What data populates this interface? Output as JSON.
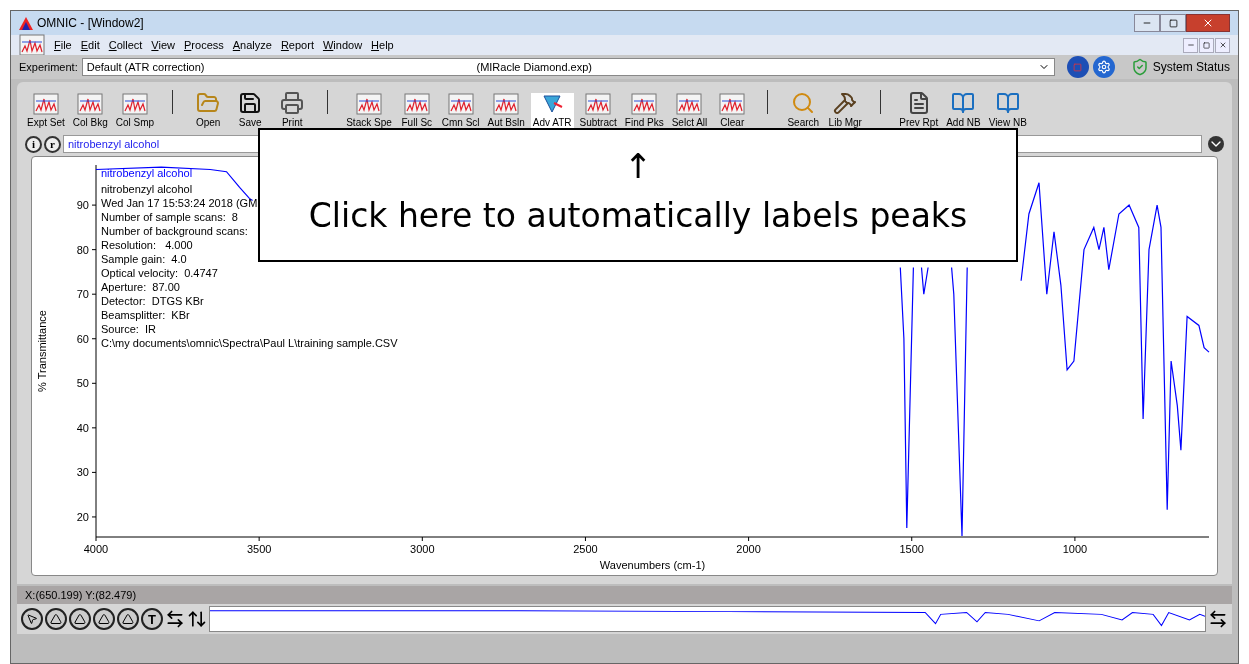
{
  "window": {
    "title": "OMNIC - [Window2]"
  },
  "menu": [
    "File",
    "Edit",
    "Collect",
    "View",
    "Process",
    "Analyze",
    "Report",
    "Window",
    "Help"
  ],
  "experiment": {
    "label": "Experiment:",
    "value": "Default (ATR correction)",
    "file": "(MIRacle Diamond.exp)",
    "status": "System Status"
  },
  "toolbar": [
    [
      {
        "label": "Expt Set",
        "kind": "spectra"
      },
      {
        "label": "Col Bkg",
        "kind": "spectra"
      },
      {
        "label": "Col Smp",
        "kind": "spectra"
      }
    ],
    [
      {
        "label": "Open",
        "kind": "open"
      },
      {
        "label": "Save",
        "kind": "save"
      },
      {
        "label": "Print",
        "kind": "print"
      }
    ],
    [
      {
        "label": "Stack Spe",
        "kind": "spectra"
      },
      {
        "label": "Full Sc",
        "kind": "spectra"
      },
      {
        "label": "Cmn Scl",
        "kind": "spectra"
      },
      {
        "label": "Aut Bsln",
        "kind": "spectra"
      },
      {
        "label": "Adv ATR",
        "kind": "atr"
      },
      {
        "label": "Subtract",
        "kind": "spectra"
      },
      {
        "label": "Find Pks",
        "kind": "spectra"
      },
      {
        "label": "Selct All",
        "kind": "spectra"
      },
      {
        "label": "Clear",
        "kind": "spectra"
      }
    ],
    [
      {
        "label": "Search",
        "kind": "search"
      },
      {
        "label": "Lib Mgr",
        "kind": "library"
      }
    ],
    [
      {
        "label": "Prev Rpt",
        "kind": "report"
      },
      {
        "label": "Add NB",
        "kind": "notebook"
      },
      {
        "label": "View NB",
        "kind": "notebook"
      }
    ]
  ],
  "spectrum_bar": {
    "info_button": "i",
    "region_button": "r",
    "value": "nitrobenzyl alcohol"
  },
  "plot": {
    "info": [
      "nitrobenzyl alcohol",
      "Wed Jan 17 15:53:24 2018 (GM",
      "Number of sample scans:  8",
      "Number of background scans:",
      "Resolution:   4.000",
      "Sample gain:  4.0",
      "Optical velocity:  0.4747",
      "Aperture:  87.00",
      "Detector:  DTGS KBr",
      "Beamsplitter:  KBr",
      "Source:  IR",
      "C:\\my documents\\omnic\\Spectra\\Paul L\\training sample.CSV"
    ],
    "chart_data": {
      "type": "line",
      "xlabel": "Wavenumbers (cm-1)",
      "ylabel": "% Transmittance",
      "x": [
        4000,
        3800,
        3650,
        3600,
        3560,
        3530,
        3520,
        3000,
        1535,
        1524,
        1515,
        1495,
        1480,
        1470,
        1463,
        1450,
        1390,
        1378,
        1371,
        1346,
        1330,
        1200,
        1165,
        1141,
        1110,
        1086,
        1064,
        1043,
        1024,
        1003,
        972,
        942,
        926,
        911,
        896,
        865,
        834,
        804,
        791,
        773,
        748,
        736,
        717,
        705,
        686,
        675,
        656,
        620,
        604,
        589
      ],
      "series": [
        {
          "name": "nitrobenzyl alcohol",
          "color": "#0000ff",
          "values": [
            98,
            98.5,
            98,
            97.5,
            94,
            91.5,
            91,
            null,
            76,
            60,
            17.5,
            76,
            null,
            76,
            70,
            76,
            null,
            76,
            70,
            15.7,
            76,
            null,
            73,
            88,
            95,
            70,
            84,
            72,
            53,
            55,
            80,
            85,
            80,
            85,
            75.5,
            88,
            90,
            85,
            42,
            80,
            90,
            85,
            21.6,
            55,
            45,
            35,
            65,
            63,
            58,
            57
          ]
        }
      ],
      "xlim": [
        4000,
        589
      ],
      "ylim": [
        15.5,
        99
      ],
      "xticks": [
        4000,
        3500,
        3000,
        2500,
        2000,
        1500,
        1000
      ],
      "yticks": [
        20,
        30,
        40,
        50,
        60,
        70,
        80,
        90
      ]
    }
  },
  "callout": {
    "arrow": "↑",
    "text": "Click here to automatically labels peaks"
  },
  "status_bar": "X:(650.199) Y:(82.479)",
  "text_tool": "T"
}
